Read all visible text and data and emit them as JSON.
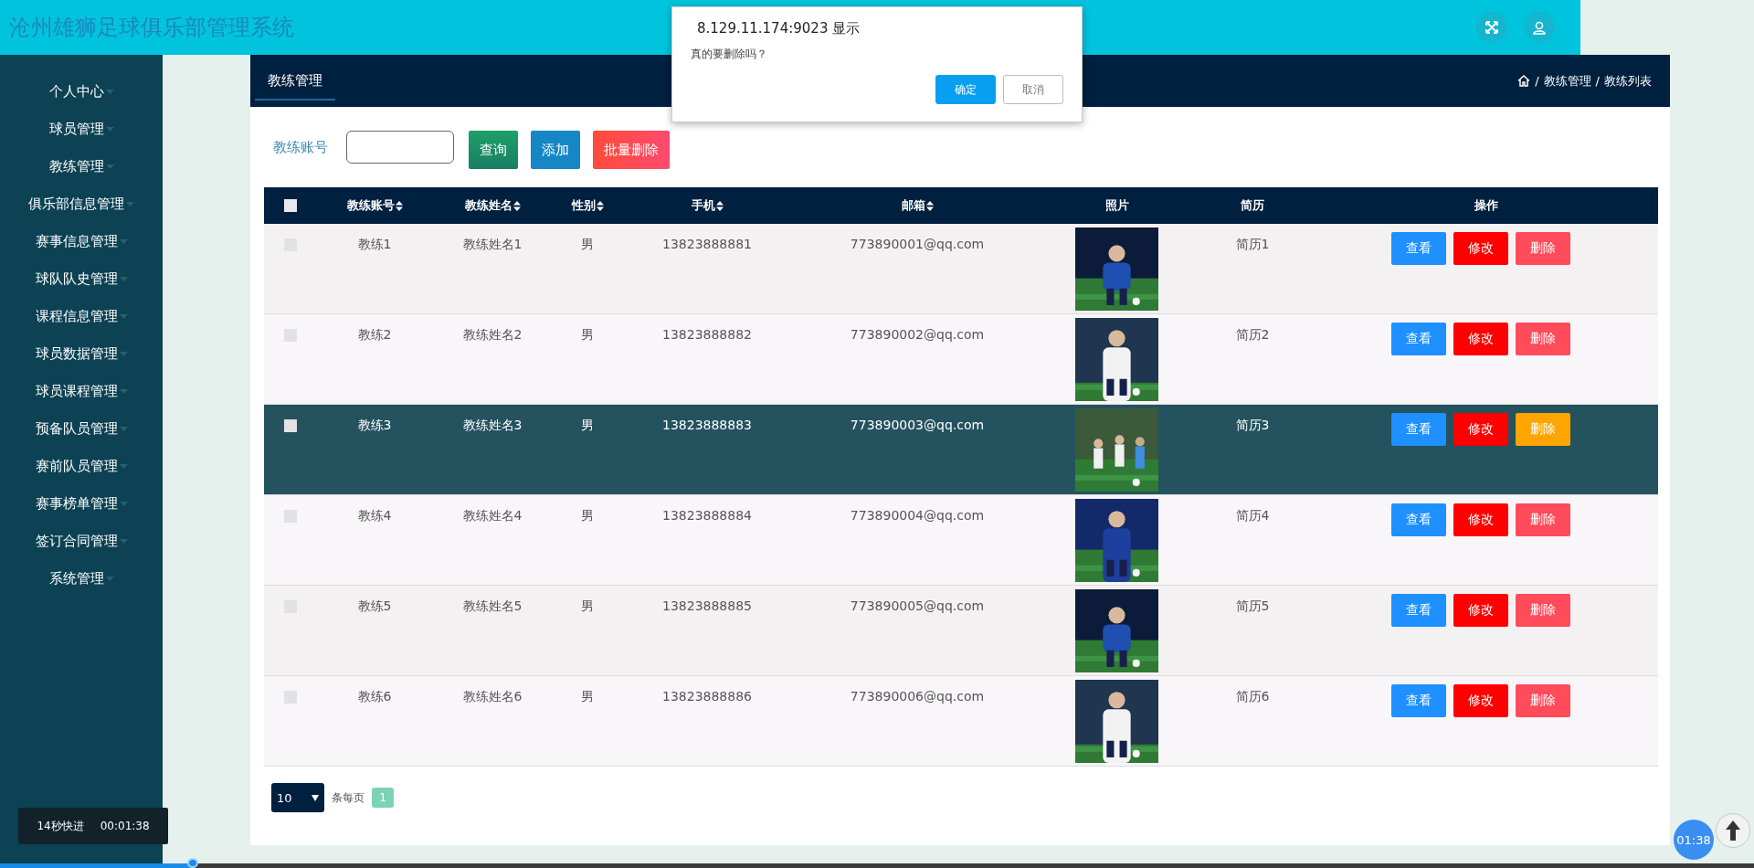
{
  "header": {
    "title": "沧州雄狮足球俱乐部管理系统"
  },
  "sidebar": {
    "items": [
      {
        "label": "个人中心"
      },
      {
        "label": "球员管理"
      },
      {
        "label": "教练管理"
      },
      {
        "label": "俱乐部信息管理"
      },
      {
        "label": "赛事信息管理"
      },
      {
        "label": "球队队史管理"
      },
      {
        "label": "课程信息管理"
      },
      {
        "label": "球员数据管理"
      },
      {
        "label": "球员课程管理"
      },
      {
        "label": "预备队员管理"
      },
      {
        "label": "赛前队员管理"
      },
      {
        "label": "赛事榜单管理"
      },
      {
        "label": "签订合同管理"
      },
      {
        "label": "系统管理"
      }
    ]
  },
  "panel": {
    "tab": "教练管理",
    "breadcrumb": {
      "separator": "/",
      "items": [
        "教练管理",
        "教练列表"
      ]
    }
  },
  "search": {
    "label": "教练账号",
    "buttons": [
      {
        "label": "查询",
        "kind": "search"
      },
      {
        "label": "添加",
        "kind": "add"
      },
      {
        "label": "批量删除",
        "kind": "delete"
      }
    ]
  },
  "table": {
    "columns": [
      {
        "label": "教练账号",
        "sortable": true
      },
      {
        "label": "教练姓名",
        "sortable": true
      },
      {
        "label": "性别",
        "sortable": true
      },
      {
        "label": "手机",
        "sortable": true
      },
      {
        "label": "邮箱",
        "sortable": true
      },
      {
        "label": "照片",
        "sortable": false
      },
      {
        "label": "简历",
        "sortable": false
      },
      {
        "label": "操作",
        "sortable": false
      }
    ],
    "all_checked": false,
    "rows": [
      {
        "checked": false,
        "hovered": false,
        "cells": [
          "教练1",
          "教练姓名1",
          "男",
          "13823888881",
          "773890001@qq.com",
          "简历1"
        ],
        "actions": [
          "查看",
          "修改",
          "删除"
        ]
      },
      {
        "checked": false,
        "hovered": false,
        "cells": [
          "教练2",
          "教练姓名2",
          "男",
          "13823888882",
          "773890002@qq.com",
          "简历2"
        ],
        "actions": [
          "查看",
          "修改",
          "删除"
        ]
      },
      {
        "checked": false,
        "hovered": true,
        "cells": [
          "教练3",
          "教练姓名3",
          "男",
          "13823888883",
          "773890003@qq.com",
          "简历3"
        ],
        "actions": [
          "查看",
          "修改",
          "删除"
        ]
      },
      {
        "checked": false,
        "hovered": false,
        "cells": [
          "教练4",
          "教练姓名4",
          "男",
          "13823888884",
          "773890004@qq.com",
          "简历4"
        ],
        "actions": [
          "查看",
          "修改",
          "删除"
        ]
      },
      {
        "checked": false,
        "hovered": false,
        "cells": [
          "教练5",
          "教练姓名5",
          "男",
          "13823888885",
          "773890005@qq.com",
          "简历5"
        ],
        "actions": [
          "查看",
          "修改",
          "删除"
        ]
      },
      {
        "checked": false,
        "hovered": false,
        "cells": [
          "教练6",
          "教练姓名6",
          "男",
          "13823888886",
          "773890006@qq.com",
          "简历6"
        ],
        "actions": [
          "查看",
          "修改",
          "删除"
        ]
      }
    ]
  },
  "pagination": {
    "page_size": "10",
    "per_page_label": "条每页",
    "pages": [
      {
        "label": "1",
        "selected": true
      }
    ]
  },
  "dialog": {
    "title": "8.129.11.174:9023 显示",
    "message": "真的要删除吗？",
    "buttons": [
      {
        "label": "确定",
        "kind": "primary"
      },
      {
        "label": "取消",
        "kind": "secondary"
      }
    ]
  },
  "player": {
    "skip_label": "14秒快进",
    "time": "00:01:38",
    "badge_time": "01:38",
    "level": 0.11
  }
}
